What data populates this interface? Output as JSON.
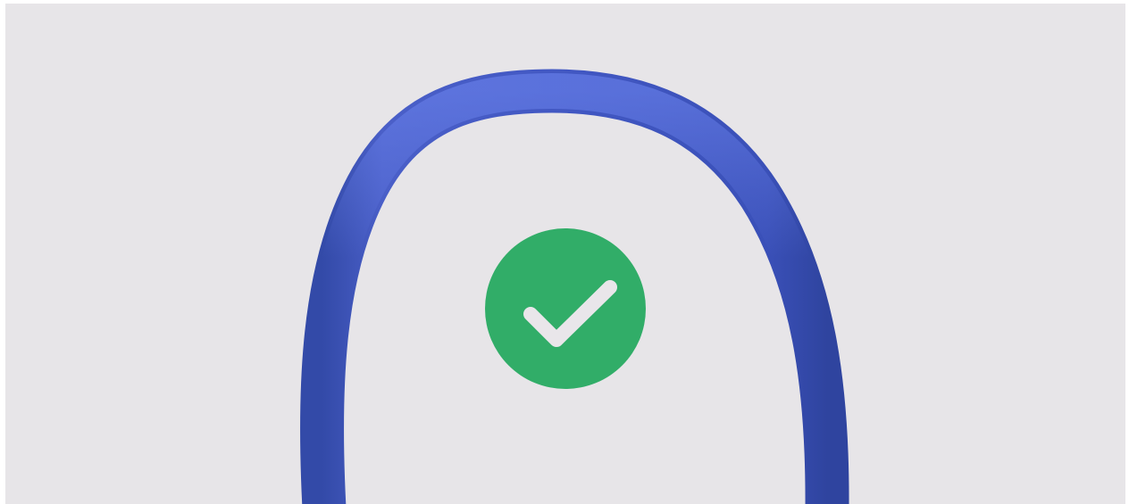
{
  "illustration": {
    "background_color": "#e7e5e8",
    "outline_color": "#3f55c0",
    "icon": "checkmark-icon",
    "status": "success",
    "badge_color": "#31ad68",
    "check_color": "#e9e6ea"
  }
}
